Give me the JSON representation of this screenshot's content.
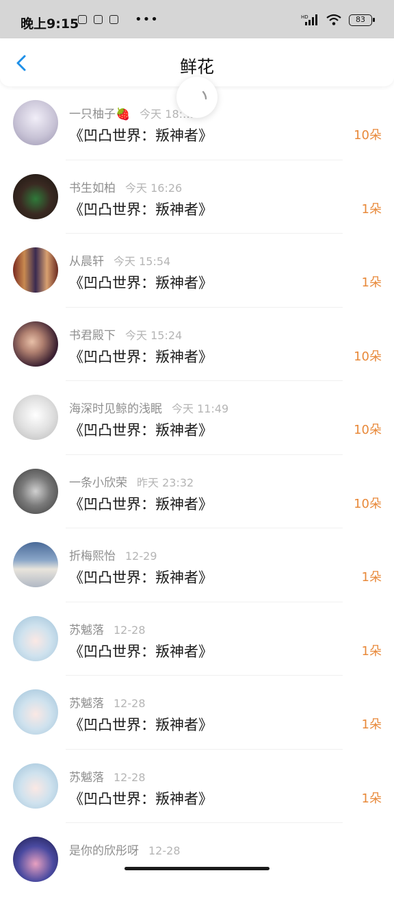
{
  "status_bar": {
    "time": "晚上9:15",
    "battery": "83",
    "dots": "•••"
  },
  "header": {
    "title": "鲜花"
  },
  "list": [
    {
      "name": "一只柚子🍓",
      "time": "今天 18:…",
      "book": "《凹凸世界：叛神者》",
      "count": "10朵",
      "avatar_color": "#c8c3d6"
    },
    {
      "name": "书生如柏",
      "time": "今天 16:26",
      "book": "《凹凸世界：叛神者》",
      "count": "1朵",
      "avatar_color": "#3a2a22"
    },
    {
      "name": "从晨轩",
      "time": "今天 15:54",
      "book": "《凹凸世界：叛神者》",
      "count": "1朵",
      "avatar_color": "#8a4030"
    },
    {
      "name": "书君殿下",
      "time": "今天 15:24",
      "book": "《凹凸世界：叛神者》",
      "count": "10朵",
      "avatar_color": "#5a3a4a"
    },
    {
      "name": "海深时见鲸的浅眠",
      "time": "今天 11:49",
      "book": "《凹凸世界：叛神者》",
      "count": "10朵",
      "avatar_color": "#d8d8d8"
    },
    {
      "name": "一条小欣荣",
      "time": "昨天 23:32",
      "book": "《凹凸世界：叛神者》",
      "count": "10朵",
      "avatar_color": "#6a6a6a"
    },
    {
      "name": "折梅熙怡",
      "time": "12-29",
      "book": "《凹凸世界：叛神者》",
      "count": "1朵",
      "avatar_color": "#7f98b8"
    },
    {
      "name": "苏魆落",
      "time": "12-28",
      "book": "《凹凸世界：叛神者》",
      "count": "1朵",
      "avatar_color": "#b9d3e4"
    },
    {
      "name": "苏魆落",
      "time": "12-28",
      "book": "《凹凸世界：叛神者》",
      "count": "1朵",
      "avatar_color": "#b9d3e4"
    },
    {
      "name": "苏魆落",
      "time": "12-28",
      "book": "《凹凸世界：叛神者》",
      "count": "1朵",
      "avatar_color": "#b9d3e4"
    },
    {
      "name": "是你的欣彤呀",
      "time": "12-28",
      "book": "",
      "count": "",
      "avatar_color": "#3a3a6a"
    }
  ]
}
